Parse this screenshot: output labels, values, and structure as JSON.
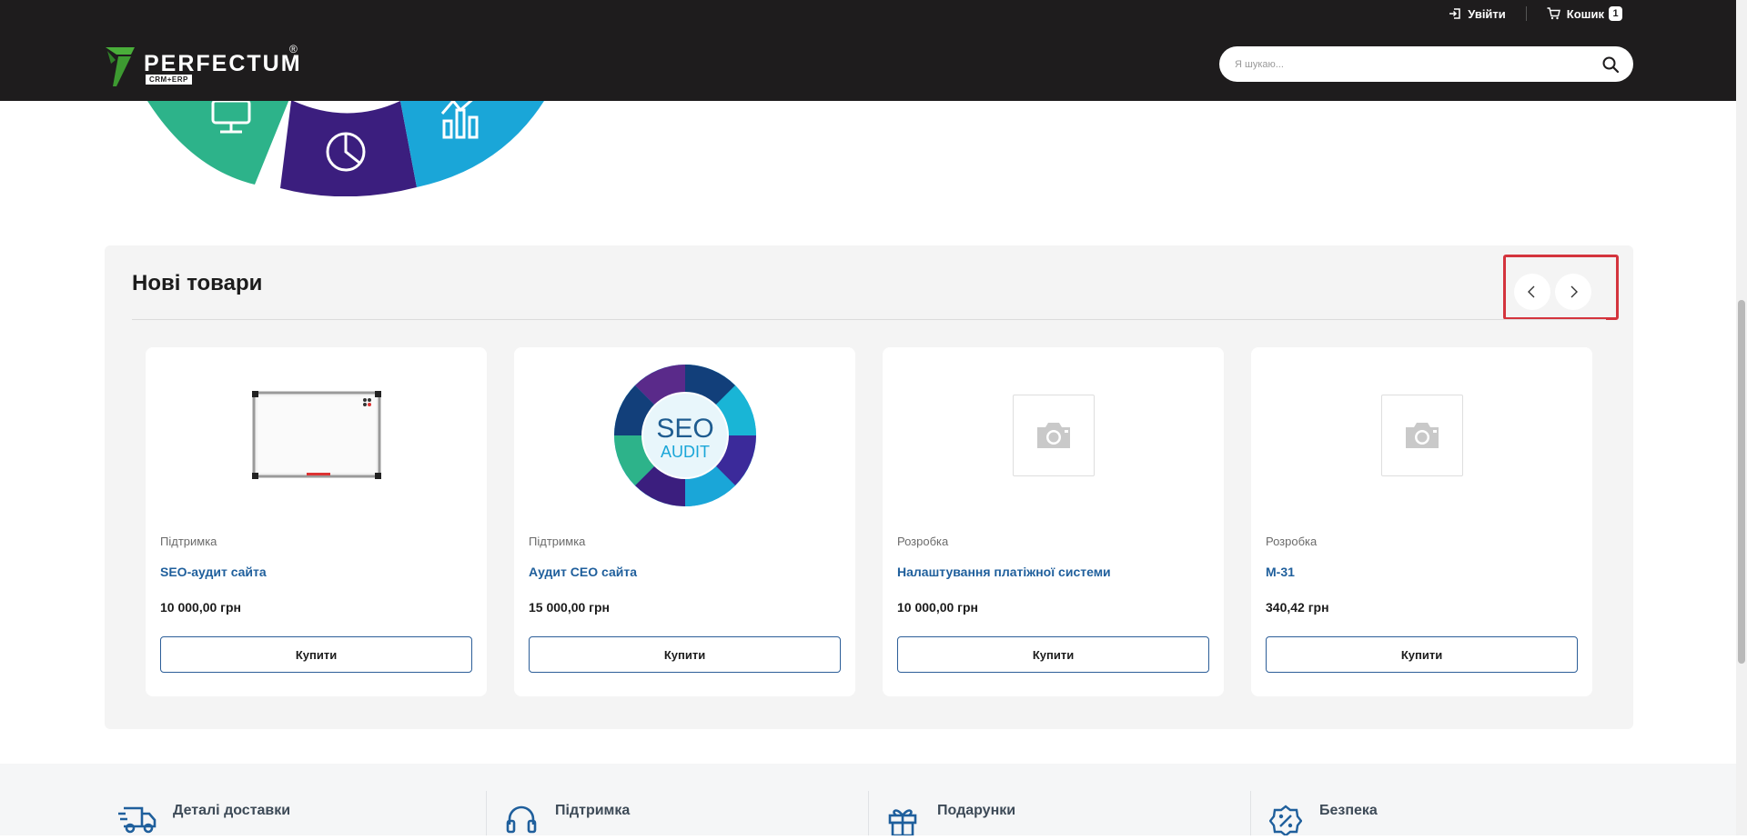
{
  "topbar": {
    "login_label": "Увійти",
    "cart_label": "Кошик",
    "cart_count": "1"
  },
  "header": {
    "logo_text": "PERFECTUM",
    "logo_badge": "CRM+ERP",
    "logo_reg": "®",
    "search_placeholder": "Я шукаю..."
  },
  "new_products": {
    "title": "Нові товари",
    "items": [
      {
        "category": "Підтримка",
        "name": "SEO-аудит сайта",
        "price": "10 000,00 грн",
        "buy_label": "Купити",
        "image": "whiteboard"
      },
      {
        "category": "Підтримка",
        "name": "Аудит СЕО сайта",
        "price": "15 000,00 грн",
        "buy_label": "Купити",
        "image": "seo-audit"
      },
      {
        "category": "Розробка",
        "name": "Налаштування платіжної системи",
        "price": "10 000,00 грн",
        "buy_label": "Купити",
        "image": "camera-placeholder"
      },
      {
        "category": "Розробка",
        "name": "М-31",
        "price": "340,42 грн",
        "buy_label": "Купити",
        "image": "camera-placeholder"
      }
    ]
  },
  "seo_audit_image": {
    "line1": "SEO",
    "line2": "AUDIT"
  },
  "features": [
    {
      "title": "Деталі доставки",
      "icon": "truck-icon"
    },
    {
      "title": "Підтримка",
      "icon": "headset-icon"
    },
    {
      "title": "Подарунки",
      "icon": "gift-icon"
    },
    {
      "title": "Безпека",
      "icon": "percent-badge-icon"
    }
  ],
  "colors": {
    "header_bg": "#1e1c1d",
    "logo_green": "#4aae3a",
    "link_blue": "#1f5f9c",
    "highlight_red": "#d4343d",
    "section_bg": "#f4f4f4"
  }
}
